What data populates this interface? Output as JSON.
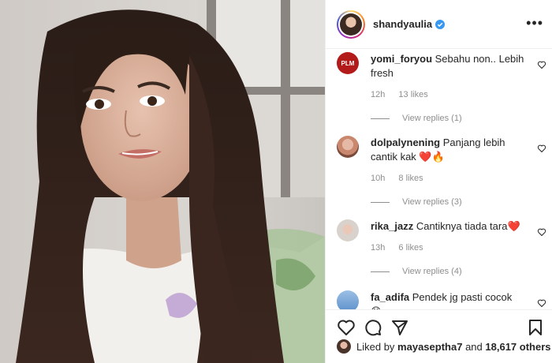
{
  "post": {
    "username": "shandyaulia",
    "more_label": "•••"
  },
  "comments": [
    {
      "username": "yomi_foryou",
      "text": "Sebahu non.. Lebih fresh",
      "time": "12h",
      "likes": "13 likes",
      "replies": "View replies (1)",
      "avatar_text": "PLM"
    },
    {
      "username": "dolpalynening",
      "text": "Panjang lebih cantik kak ❤️🔥",
      "time": "10h",
      "likes": "8 likes",
      "replies": "View replies (3)"
    },
    {
      "username": "rika_jazz",
      "text": "Cantiknya tiada tara❤️",
      "time": "13h",
      "likes": "6 likes",
      "replies": "View replies (4)"
    },
    {
      "username": "fa_adifa",
      "text": "Pendek jg pasti cocok 😊"
    }
  ],
  "likes_bar": {
    "prefix": "Liked by",
    "user": "mayaseptha7",
    "and": "and",
    "others": "18,617 others"
  },
  "colors": {
    "verified": "#3897f0",
    "meta": "#8e8e8e",
    "text": "#262626",
    "avatar_plm": "#b31b1b"
  },
  "icons": [
    "verified-icon",
    "more-icon",
    "heart-icon",
    "comment-icon",
    "share-icon",
    "bookmark-icon"
  ]
}
